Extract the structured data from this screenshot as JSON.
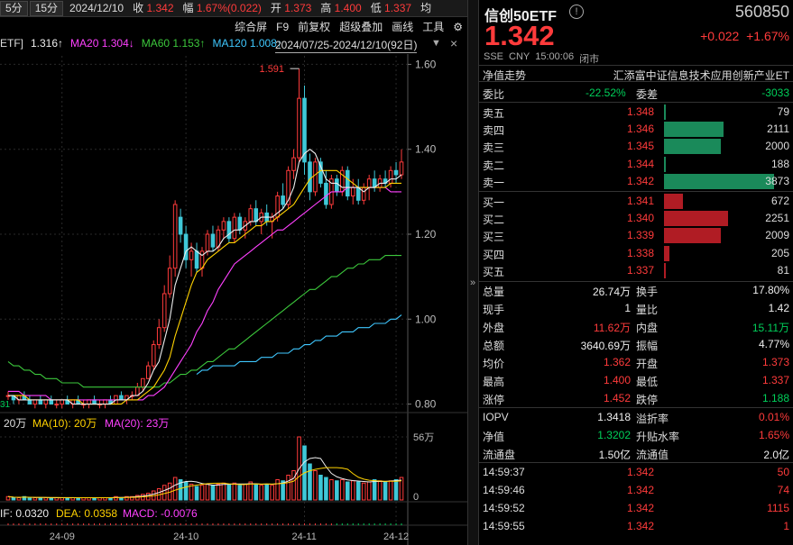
{
  "toolbar": {
    "periods": [
      "5分",
      "15分"
    ],
    "date": "2024/12/10",
    "close_label": "收",
    "close_val": "1.342",
    "range_label": "幅",
    "range_val": "1.67%(0.022)",
    "open_label": "开",
    "open_val": "1.373",
    "high_label": "高",
    "high_val": "1.400",
    "low_label": "低",
    "low_val": "1.337",
    "avg_label": "均",
    "menu": [
      "综合屏",
      "F9",
      "前复权",
      "超级叠加",
      "画线",
      "工具"
    ],
    "gear_icon": "gear-icon",
    "ticker_partial": "ETF]"
  },
  "ma_row": {
    "ma5": "1.316↑",
    "ma20": "MA20 1.304↓",
    "ma60": "MA60 1.153↑",
    "ma120": "MA120 1.008↑",
    "date_range": "2024/07/25-2024/12/10(92日)"
  },
  "price_axis": [
    "1.60",
    "1.40",
    "1.20",
    "1.00",
    "0.80"
  ],
  "annotations": {
    "high_marker": "1.591",
    "low_marker": "31"
  },
  "volume": {
    "label_row": {
      "v": "20万",
      "ma10": "MA(10): 20万",
      "ma20": "MA(20): 23万"
    },
    "axis": [
      "56万",
      "0"
    ]
  },
  "macd": {
    "dif": "IF: 0.0320",
    "dea": "DEA: 0.0358",
    "macd": "MACD: -0.0076"
  },
  "x_axis": [
    "24-09",
    "24-10",
    "24-11",
    "24-12"
  ],
  "colors": {
    "up": "#ff3b3b",
    "down": "#00d05a",
    "ma5": "#eeeeee",
    "ma10": "#ffd200",
    "ma20": "#ff40ff",
    "ma60": "#3cc83c",
    "ma120": "#3fc8ff",
    "bar_buy": "#b01c24",
    "bar_sell": "#1a8a5a"
  },
  "right": {
    "title": "信创50ETF",
    "code": "560850",
    "price": "1.342",
    "change": "+0.022",
    "change_pct": "+1.67%",
    "meta": [
      "SSE",
      "CNY",
      "15:00:06",
      "闭市"
    ],
    "tab_left": "净值走势",
    "tab_right": "汇添富中证信息技术应用创新产业ET",
    "weibi_label": "委比",
    "weibi_val": "-22.52%",
    "weicha_label": "委差",
    "weicha_val": "-3033",
    "asks": [
      {
        "label": "卖五",
        "price": "1.348",
        "vol": "79",
        "w": 0
      },
      {
        "label": "卖四",
        "price": "1.346",
        "vol": "2111",
        "w": 0.545
      },
      {
        "label": "卖三",
        "price": "1.345",
        "vol": "2000",
        "w": 0.516
      },
      {
        "label": "卖二",
        "price": "1.344",
        "vol": "188",
        "w": 0.02
      },
      {
        "label": "卖一",
        "price": "1.342",
        "vol": "3873",
        "w": 1.0
      }
    ],
    "bids": [
      {
        "label": "买一",
        "price": "1.341",
        "vol": "672",
        "w": 0.174
      },
      {
        "label": "买二",
        "price": "1.340",
        "vol": "2251",
        "w": 0.581
      },
      {
        "label": "买三",
        "price": "1.339",
        "vol": "2009",
        "w": 0.519
      },
      {
        "label": "买四",
        "price": "1.338",
        "vol": "205",
        "w": 0.053
      },
      {
        "label": "买五",
        "price": "1.337",
        "vol": "81",
        "w": 0.02
      }
    ],
    "stats": [
      {
        "l1": "总量",
        "v1": "26.74万",
        "c1": "white",
        "l2": "换手",
        "v2": "17.80%",
        "c2": "white"
      },
      {
        "l1": "现手",
        "v1": "1",
        "c1": "white",
        "l2": "量比",
        "v2": "1.42",
        "c2": "white"
      },
      {
        "l1": "外盘",
        "v1": "11.62万",
        "c1": "red",
        "l2": "内盘",
        "v2": "15.11万",
        "c2": "green"
      },
      {
        "l1": "总额",
        "v1": "3640.69万",
        "c1": "white",
        "l2": "振幅",
        "v2": "4.77%",
        "c2": "white"
      },
      {
        "l1": "均价",
        "v1": "1.362",
        "c1": "red",
        "l2": "开盘",
        "v2": "1.373",
        "c2": "red"
      },
      {
        "l1": "最高",
        "v1": "1.400",
        "c1": "red",
        "l2": "最低",
        "v2": "1.337",
        "c2": "red"
      },
      {
        "l1": "涨停",
        "v1": "1.452",
        "c1": "red",
        "l2": "跌停",
        "v2": "1.188",
        "c2": "green"
      }
    ],
    "iopv": [
      {
        "l1": "IOPV",
        "v1": "1.3418",
        "c1": "white",
        "l2": "溢折率",
        "v2": "0.01%",
        "c2": "red"
      },
      {
        "l1": "净值",
        "v1": "1.3202",
        "c1": "green",
        "l2": "升贴水率",
        "v2": "1.65%",
        "c2": "red"
      },
      {
        "l1": "流通盘",
        "v1": "1.50亿",
        "c1": "white",
        "l2": "流通值",
        "v2": "2.0亿",
        "c2": "white"
      }
    ],
    "ticks": [
      {
        "time": "14:59:37",
        "price": "1.342",
        "vol": "50"
      },
      {
        "time": "14:59:46",
        "price": "1.342",
        "vol": "74"
      },
      {
        "time": "14:59:52",
        "price": "1.342",
        "vol": "1115"
      },
      {
        "time": "14:59:55",
        "price": "1.342",
        "vol": "1"
      }
    ]
  },
  "chart_data": {
    "type": "candlestick",
    "title": "信创50ETF",
    "price_range": [
      0.78,
      1.62
    ],
    "candles": [
      [
        0.82,
        0.83,
        0.81,
        0.82
      ],
      [
        0.82,
        0.82,
        0.8,
        0.81
      ],
      [
        0.81,
        0.82,
        0.8,
        0.82
      ],
      [
        0.82,
        0.83,
        0.81,
        0.81
      ],
      [
        0.81,
        0.82,
        0.8,
        0.8
      ],
      [
        0.8,
        0.81,
        0.79,
        0.81
      ],
      [
        0.81,
        0.82,
        0.8,
        0.8
      ],
      [
        0.8,
        0.81,
        0.79,
        0.81
      ],
      [
        0.81,
        0.82,
        0.8,
        0.8
      ],
      [
        0.8,
        0.81,
        0.79,
        0.8
      ],
      [
        0.8,
        0.81,
        0.79,
        0.81
      ],
      [
        0.81,
        0.82,
        0.8,
        0.8
      ],
      [
        0.8,
        0.81,
        0.79,
        0.81
      ],
      [
        0.81,
        0.82,
        0.8,
        0.8
      ],
      [
        0.8,
        0.81,
        0.79,
        0.8
      ],
      [
        0.8,
        0.81,
        0.79,
        0.81
      ],
      [
        0.81,
        0.82,
        0.8,
        0.8
      ],
      [
        0.8,
        0.81,
        0.79,
        0.8
      ],
      [
        0.8,
        0.81,
        0.79,
        0.81
      ],
      [
        0.81,
        0.82,
        0.8,
        0.8
      ],
      [
        0.8,
        0.82,
        0.8,
        0.82
      ],
      [
        0.82,
        0.83,
        0.81,
        0.81
      ],
      [
        0.81,
        0.82,
        0.8,
        0.82
      ],
      [
        0.82,
        0.83,
        0.81,
        0.82
      ],
      [
        0.82,
        0.85,
        0.82,
        0.84
      ],
      [
        0.84,
        0.86,
        0.83,
        0.86
      ],
      [
        0.86,
        0.9,
        0.86,
        0.89
      ],
      [
        0.89,
        0.95,
        0.88,
        0.94
      ],
      [
        0.94,
        1.0,
        0.93,
        0.98
      ],
      [
        0.98,
        1.08,
        0.97,
        1.06
      ],
      [
        1.06,
        1.15,
        1.05,
        1.12
      ],
      [
        1.12,
        1.28,
        1.1,
        1.27
      ],
      [
        1.24,
        1.26,
        1.18,
        1.2
      ],
      [
        1.2,
        1.22,
        1.12,
        1.14
      ],
      [
        1.14,
        1.18,
        1.1,
        1.16
      ],
      [
        1.16,
        1.18,
        1.11,
        1.12
      ],
      [
        1.12,
        1.17,
        1.1,
        1.16
      ],
      [
        1.16,
        1.21,
        1.15,
        1.2
      ],
      [
        1.2,
        1.22,
        1.16,
        1.17
      ],
      [
        1.17,
        1.22,
        1.16,
        1.21
      ],
      [
        1.21,
        1.24,
        1.19,
        1.23
      ],
      [
        1.23,
        1.24,
        1.18,
        1.19
      ],
      [
        1.19,
        1.25,
        1.18,
        1.24
      ],
      [
        1.24,
        1.25,
        1.2,
        1.21
      ],
      [
        1.21,
        1.24,
        1.19,
        1.23
      ],
      [
        1.23,
        1.27,
        1.22,
        1.26
      ],
      [
        1.26,
        1.28,
        1.22,
        1.23
      ],
      [
        1.23,
        1.26,
        1.2,
        1.25
      ],
      [
        1.25,
        1.27,
        1.22,
        1.23
      ],
      [
        1.23,
        1.25,
        1.19,
        1.24
      ],
      [
        1.24,
        1.3,
        1.23,
        1.29
      ],
      [
        1.29,
        1.32,
        1.26,
        1.27
      ],
      [
        1.27,
        1.36,
        1.26,
        1.35
      ],
      [
        1.35,
        1.4,
        1.33,
        1.38
      ],
      [
        1.38,
        1.59,
        1.37,
        1.52
      ],
      [
        1.52,
        1.55,
        1.34,
        1.37
      ],
      [
        1.37,
        1.39,
        1.28,
        1.3
      ],
      [
        1.3,
        1.38,
        1.29,
        1.37
      ],
      [
        1.37,
        1.38,
        1.31,
        1.32
      ],
      [
        1.32,
        1.35,
        1.26,
        1.27
      ],
      [
        1.27,
        1.34,
        1.26,
        1.33
      ],
      [
        1.33,
        1.34,
        1.29,
        1.3
      ],
      [
        1.3,
        1.36,
        1.29,
        1.35
      ],
      [
        1.35,
        1.36,
        1.28,
        1.29
      ],
      [
        1.29,
        1.33,
        1.27,
        1.31
      ],
      [
        1.31,
        1.33,
        1.27,
        1.28
      ],
      [
        1.28,
        1.32,
        1.27,
        1.31
      ],
      [
        1.31,
        1.34,
        1.28,
        1.33
      ],
      [
        1.33,
        1.35,
        1.3,
        1.31
      ],
      [
        1.31,
        1.34,
        1.3,
        1.33
      ],
      [
        1.33,
        1.35,
        1.31,
        1.32
      ],
      [
        1.32,
        1.36,
        1.31,
        1.35
      ],
      [
        1.35,
        1.37,
        1.32,
        1.34
      ],
      [
        1.34,
        1.4,
        1.33,
        1.37
      ]
    ],
    "ma5": [
      0.82,
      0.82,
      0.81,
      0.81,
      0.81,
      0.81,
      0.81,
      0.81,
      0.81,
      0.81,
      0.81,
      0.81,
      0.8,
      0.8,
      0.8,
      0.8,
      0.8,
      0.8,
      0.8,
      0.8,
      0.81,
      0.81,
      0.81,
      0.82,
      0.82,
      0.83,
      0.85,
      0.88,
      0.9,
      0.95,
      1.0,
      1.08,
      1.12,
      1.16,
      1.17,
      1.16,
      1.15,
      1.16,
      1.16,
      1.17,
      1.19,
      1.2,
      1.21,
      1.21,
      1.22,
      1.23,
      1.23,
      1.24,
      1.24,
      1.24,
      1.25,
      1.26,
      1.28,
      1.31,
      1.37,
      1.39,
      1.4,
      1.39,
      1.36,
      1.33,
      1.32,
      1.32,
      1.31,
      1.31,
      1.31,
      1.31,
      1.3,
      1.31,
      1.31,
      1.32,
      1.32,
      1.33,
      1.33,
      1.34
    ],
    "ma10": [
      0.82,
      0.82,
      0.82,
      0.82,
      0.81,
      0.81,
      0.81,
      0.81,
      0.81,
      0.81,
      0.81,
      0.81,
      0.81,
      0.81,
      0.8,
      0.8,
      0.8,
      0.8,
      0.8,
      0.8,
      0.8,
      0.8,
      0.81,
      0.81,
      0.81,
      0.82,
      0.83,
      0.84,
      0.86,
      0.88,
      0.91,
      0.96,
      1.0,
      1.04,
      1.08,
      1.11,
      1.12,
      1.14,
      1.15,
      1.16,
      1.17,
      1.18,
      1.18,
      1.19,
      1.2,
      1.21,
      1.22,
      1.22,
      1.23,
      1.23,
      1.24,
      1.25,
      1.26,
      1.27,
      1.29,
      1.31,
      1.33,
      1.34,
      1.35,
      1.35,
      1.35,
      1.35,
      1.34,
      1.33,
      1.32,
      1.31,
      1.31,
      1.31,
      1.31,
      1.31,
      1.31,
      1.32,
      1.32,
      1.32
    ],
    "ma20": [
      0.83,
      0.83,
      0.83,
      0.82,
      0.82,
      0.82,
      0.82,
      0.82,
      0.81,
      0.81,
      0.81,
      0.81,
      0.81,
      0.81,
      0.81,
      0.81,
      0.81,
      0.81,
      0.81,
      0.81,
      0.81,
      0.81,
      0.81,
      0.81,
      0.81,
      0.81,
      0.82,
      0.82,
      0.83,
      0.84,
      0.86,
      0.88,
      0.9,
      0.92,
      0.94,
      0.97,
      0.99,
      1.02,
      1.04,
      1.07,
      1.09,
      1.11,
      1.13,
      1.14,
      1.15,
      1.16,
      1.17,
      1.18,
      1.19,
      1.2,
      1.21,
      1.21,
      1.22,
      1.23,
      1.24,
      1.25,
      1.26,
      1.27,
      1.28,
      1.29,
      1.3,
      1.3,
      1.3,
      1.31,
      1.31,
      1.31,
      1.31,
      1.31,
      1.31,
      1.31,
      1.31,
      1.3,
      1.3,
      1.3
    ],
    "ma60": [
      0.9,
      0.89,
      0.89,
      0.88,
      0.88,
      0.87,
      0.87,
      0.86,
      0.86,
      0.86,
      0.85,
      0.85,
      0.85,
      0.85,
      0.84,
      0.84,
      0.84,
      0.84,
      0.84,
      0.84,
      0.84,
      0.84,
      0.84,
      0.84,
      0.84,
      0.84,
      0.84,
      0.84,
      0.84,
      0.85,
      0.85,
      0.86,
      0.87,
      0.87,
      0.88,
      0.88,
      0.89,
      0.9,
      0.9,
      0.91,
      0.92,
      0.93,
      0.93,
      0.94,
      0.95,
      0.96,
      0.97,
      0.98,
      0.99,
      1.0,
      1.01,
      1.02,
      1.03,
      1.04,
      1.05,
      1.06,
      1.07,
      1.07,
      1.08,
      1.09,
      1.1,
      1.1,
      1.11,
      1.12,
      1.12,
      1.13,
      1.13,
      1.14,
      1.14,
      1.14,
      1.15,
      1.15,
      1.15,
      1.15
    ],
    "ma120_start": 35,
    "ma120": [
      0.87,
      0.88,
      0.88,
      0.89,
      0.89,
      0.89,
      0.89,
      0.89,
      0.9,
      0.9,
      0.9,
      0.9,
      0.91,
      0.91,
      0.91,
      0.92,
      0.92,
      0.92,
      0.93,
      0.93,
      0.94,
      0.94,
      0.95,
      0.95,
      0.96,
      0.96,
      0.96,
      0.97,
      0.97,
      0.97,
      0.98,
      0.98,
      0.98,
      0.99,
      0.99,
      0.99,
      1.0,
      1.0,
      1.01
    ],
    "volumes": [
      3,
      2,
      2,
      3,
      2,
      2,
      2,
      2,
      2,
      2,
      2,
      2,
      2,
      2,
      2,
      2,
      2,
      2,
      2,
      2,
      3,
      2,
      3,
      3,
      4,
      5,
      6,
      8,
      10,
      13,
      15,
      20,
      18,
      16,
      14,
      12,
      13,
      14,
      13,
      14,
      15,
      14,
      15,
      13,
      14,
      16,
      14,
      13,
      14,
      13,
      18,
      17,
      22,
      26,
      56,
      48,
      32,
      26,
      22,
      20,
      18,
      17,
      18,
      16,
      17,
      16,
      15,
      16,
      18,
      17,
      16,
      17,
      18,
      20
    ],
    "volume_range": [
      0,
      60
    ]
  }
}
